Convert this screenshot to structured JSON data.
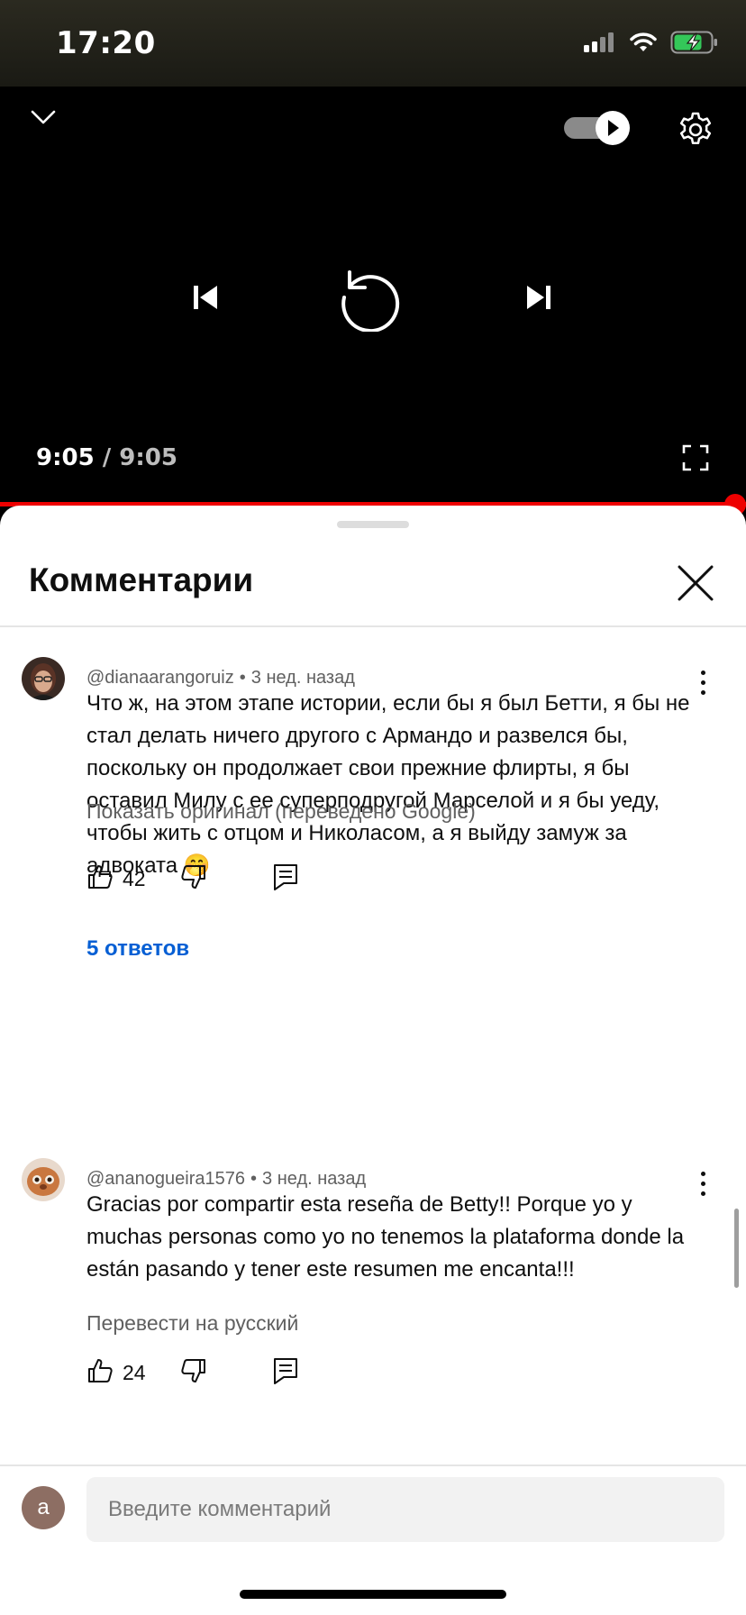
{
  "status_bar": {
    "time": "17:20",
    "icons": [
      "cellular-signal-icon",
      "wifi-icon",
      "battery-charging-icon"
    ]
  },
  "player": {
    "collapse_icon": "chevron-down-icon",
    "autoplay_icon": "autoplay-toggle-icon",
    "settings_icon": "gear-icon",
    "controls": [
      "previous-icon",
      "replay-icon",
      "next-icon"
    ],
    "time_current": "9:05",
    "time_separator": "/",
    "time_total": "9:05",
    "fullscreen_icon": "fullscreen-icon",
    "progress": 1.0,
    "progress_color": "#ee0000"
  },
  "comments_sheet": {
    "title": "Комментарии",
    "close_icon": "close-icon",
    "comments": [
      {
        "author": "@dianaarangoruiz",
        "separator": "•",
        "time": "3 нед. назад",
        "text": "Что ж, на этом этапе истории, если бы я был Бетти, я бы не стал делать ничего другого с Армандо и развелся бы, поскольку он продолжает свои прежние флирты, я бы оставил Милу с ее суперподругой Марселой и я бы уеду, чтобы жить с отцом и Николасом, а я выйду замуж за адвоката 🤭",
        "translate_label": "Показать оригинал (переведено Google)",
        "likes": "42",
        "replies_label": "5 ответов"
      },
      {
        "author": "@ananogueira1576",
        "separator": "•",
        "time": "3 нед. назад",
        "text": "Gracias por compartir esta reseña de Betty!! Porque yo y muchas personas como yo no tenemos la plataforma donde la están pasando y tener este resumen me encanta!!!",
        "translate_label": "Перевести на русский",
        "likes": "24"
      }
    ]
  },
  "composer": {
    "avatar_letter": "a",
    "avatar_color": "#8d6e63",
    "placeholder": "Введите комментарий"
  },
  "colors": {
    "link_blue": "#065fd4",
    "muted_text": "#606060",
    "accent_red": "#ee0000"
  }
}
